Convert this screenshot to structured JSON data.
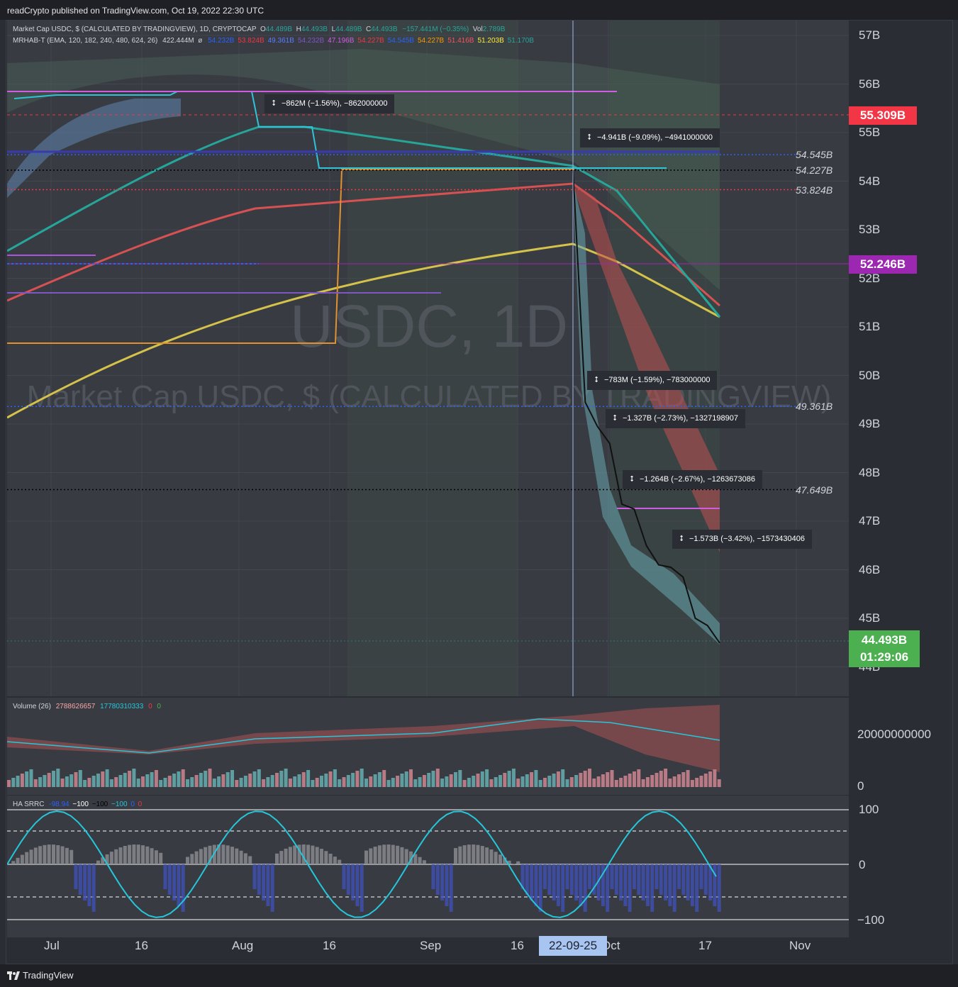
{
  "header": {
    "published_text": "readCrypto published on TradingView.com, Oct 19, 2022 22:30 UTC"
  },
  "footer": {
    "brand": "TradingView"
  },
  "legend": {
    "line1_title": "Market Cap USDC, $ (CALCULATED BY TRADINGVIEW), 1D, CRYPTOCAP",
    "ohlc": {
      "O": "44.489B",
      "H": "44.493B",
      "L": "44.489B",
      "C": "44.493B"
    },
    "change": "−157.441M (−0.35%)",
    "vol": "2.789B",
    "line2_title": "MRHAB-T (EMA, 120, 182, 240, 480, 624, 26)",
    "line2_val": "422.444M",
    "line2_values": [
      {
        "text": "54.232B",
        "color": "#2962ff"
      },
      {
        "text": "53.824B",
        "color": "#f23645"
      },
      {
        "text": "49.361B",
        "color": "#5b7cff"
      },
      {
        "text": "54.232B",
        "color": "#7e57c2"
      },
      {
        "text": "47.196B",
        "color": "#d05ce3"
      },
      {
        "text": "54.227B",
        "color": "#f23645"
      },
      {
        "text": "54.545B",
        "color": "#2962ff"
      },
      {
        "text": "54.227B",
        "color": "#ff9800"
      },
      {
        "text": "51.416B",
        "color": "#f7525f"
      },
      {
        "text": "51.203B",
        "color": "#ffeb3b"
      },
      {
        "text": "51.170B",
        "color": "#26a69a"
      }
    ]
  },
  "watermark": {
    "symbol": "USDC, 1D",
    "name": "Market Cap USDC, $ (CALCULATED BY TRADINGVIEW)"
  },
  "price_axis": {
    "ticks": [
      "57B",
      "56B",
      "55B",
      "54B",
      "53B",
      "52B",
      "51B",
      "50B",
      "49B",
      "48B",
      "47B",
      "46B",
      "45B",
      "44B"
    ],
    "badges": [
      {
        "text": "55.309B",
        "color": "#f23645"
      },
      {
        "text": "52.246B",
        "color": "#9c27b0"
      }
    ],
    "last_price": "44.493B",
    "countdown": "01:29:06"
  },
  "levels": [
    {
      "label": "54.545B",
      "value": 54.545,
      "color": "#2962ff"
    },
    {
      "label": "54.227B",
      "value": 54.227,
      "color": "#000000"
    },
    {
      "label": "53.824B",
      "value": 53.824,
      "color": "#f23645"
    },
    {
      "label": "49.361B",
      "value": 49.361,
      "color": "#2962ff"
    },
    {
      "label": "47.649B",
      "value": 47.649,
      "color": "#000000"
    }
  ],
  "measurements": [
    {
      "text": "−862M (−1.56%), −862000000"
    },
    {
      "text": "−4.941B (−9.09%), −4941000000"
    },
    {
      "text": "−783M (−1.59%), −783000000"
    },
    {
      "text": "−1.327B (−2.73%), −1327198907"
    },
    {
      "text": "−1.264B (−2.67%), −1263673086"
    },
    {
      "text": "−1.573B (−3.42%), −1573430406"
    }
  ],
  "volume_pane": {
    "title": "Volume (26)",
    "v1": "2788626657",
    "v2": "17780310333",
    "v3": "0",
    "v4": "0",
    "axis_ticks": [
      "20000000000",
      "0"
    ]
  },
  "osc_pane": {
    "title": "HA SRRC",
    "v1": "-98.94",
    "v2": "−100",
    "v3": "−100",
    "v4": "−100",
    "v5": "0",
    "v6": "0",
    "axis_ticks": [
      "100",
      "0",
      "−100"
    ]
  },
  "time_axis": {
    "ticks": [
      "Jul",
      "16",
      "Aug",
      "16",
      "Sep",
      "16",
      "Oct",
      "17",
      "Nov"
    ],
    "crosshair_label": "22-09-25"
  },
  "chart_data": {
    "type": "line",
    "title": "Market Cap USDC, $ (CALCULATED BY TRADINGVIEW), 1D, CRYPTOCAP",
    "ylabel": "",
    "ylim": [
      43.7,
      57.4
    ],
    "x": [
      "2022-09-25",
      "2022-09-27",
      "2022-09-29",
      "2022-10-01",
      "2022-10-03",
      "2022-10-05",
      "2022-10-07",
      "2022-10-09",
      "2022-10-11",
      "2022-10-13",
      "2022-10-15",
      "2022-10-17",
      "2022-10-19"
    ],
    "series": [
      {
        "values": [
          54.23,
          49.45,
          48.95,
          48.6,
          47.35,
          47.25,
          46.5,
          46.1,
          46.05,
          45.85,
          45.0,
          44.85,
          44.49
        ]
      }
    ],
    "last_value": 44.493
  }
}
